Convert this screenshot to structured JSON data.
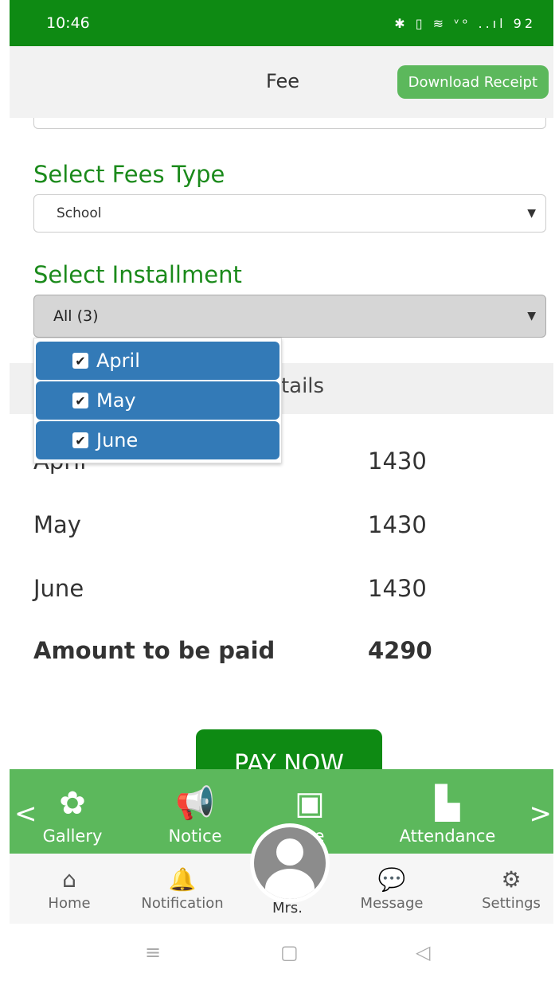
{
  "status_bar": {
    "time": "10:46",
    "icons": "✱ ▯ ≋ ᵛᵒ ..ıl 92"
  },
  "header": {
    "title": "Fee",
    "download_receipt": "Download Receipt"
  },
  "fees_type": {
    "label": "Select Fees Type",
    "value": "School",
    "caret": "▼"
  },
  "installment": {
    "label": "Select Installment",
    "value": "All (3)",
    "caret": "▼",
    "options": [
      {
        "label": "April",
        "checked": true
      },
      {
        "label": "May",
        "checked": true
      },
      {
        "label": "June",
        "checked": true
      }
    ]
  },
  "details": {
    "title": "nt Details",
    "rows": [
      {
        "label": "April",
        "amount": "1430"
      },
      {
        "label": "May",
        "amount": "1430"
      },
      {
        "label": "June",
        "amount": "1430"
      }
    ],
    "total": {
      "label": "Amount to be paid",
      "amount": "4290"
    }
  },
  "pay_button": "PAY NOW",
  "green_nav": {
    "prev": "<",
    "next": ">",
    "items": [
      {
        "label": "Gallery",
        "icon": "flower-icon"
      },
      {
        "label": "Notice",
        "icon": "megaphone-icon"
      },
      {
        "label": "Fee",
        "icon": "wallet-icon"
      },
      {
        "label": "Attendance",
        "icon": "desk-icon"
      }
    ]
  },
  "bottom_nav": {
    "items": [
      {
        "label": "Home",
        "icon": "home-icon"
      },
      {
        "label": "Notification",
        "icon": "bell-icon"
      },
      {
        "label": "Message",
        "icon": "chat-icon"
      },
      {
        "label": "Settings",
        "icon": "gear-icon"
      }
    ],
    "profile_label": "Mrs."
  },
  "system_nav": {
    "menu": "≡",
    "home": "▢",
    "back": "◁"
  },
  "colors": {
    "primary_green": "#0e8a13",
    "light_green": "#5cb85c",
    "dropdown_blue": "#337ab7",
    "label_green": "#1b8a1b"
  }
}
